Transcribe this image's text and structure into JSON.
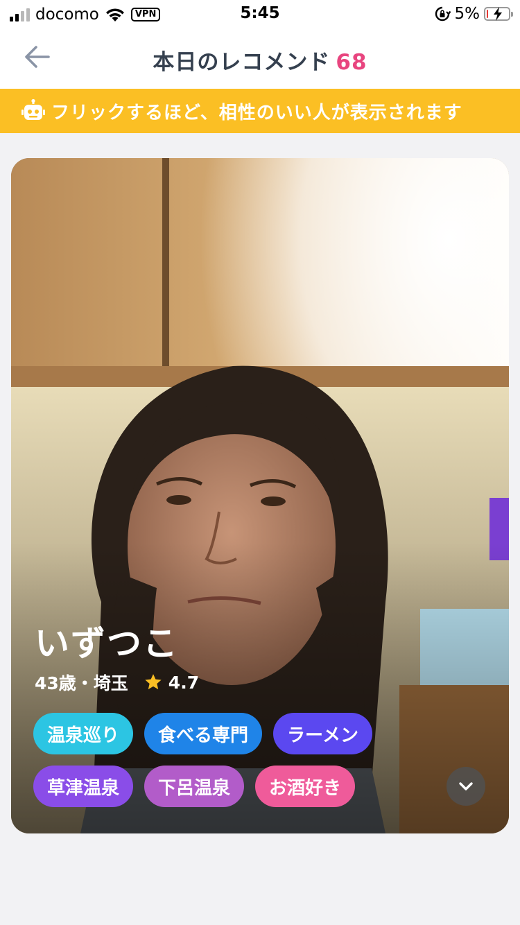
{
  "status_bar": {
    "carrier": "docomo",
    "vpn": "VPN",
    "time": "5:45",
    "battery_percent": "5%",
    "battery_level": 0.05,
    "signal_bars_filled": 2,
    "signal_bars_total": 4
  },
  "header": {
    "title": "本日のレコメンド",
    "count": "68",
    "back_icon": "arrow-left-icon"
  },
  "banner": {
    "icon": "robot-icon",
    "message": "フリックするほど、相性のいい人が表示されます",
    "color": "#fbbf24"
  },
  "profile": {
    "name": "いずつこ",
    "age_location": "43歳・埼玉",
    "rating": "4.7",
    "rating_icon": "star-icon",
    "tag_rows": [
      [
        {
          "label": "温泉巡り",
          "color": "#2cc5e3"
        },
        {
          "label": "食べる専門",
          "color": "#1f84e8"
        },
        {
          "label": "ラーメン",
          "color": "#5b48f0"
        }
      ],
      [
        {
          "label": "草津温泉",
          "color": "#8a4de8"
        },
        {
          "label": "下呂温泉",
          "color": "#b25cc9"
        },
        {
          "label": "お酒好き",
          "color": "#ef5b9a"
        }
      ]
    ],
    "expand_icon": "chevron-down-icon"
  },
  "colors": {
    "accent_count": "#e8457f",
    "title_text": "#35404f",
    "rating_star": "#fbbf24"
  }
}
